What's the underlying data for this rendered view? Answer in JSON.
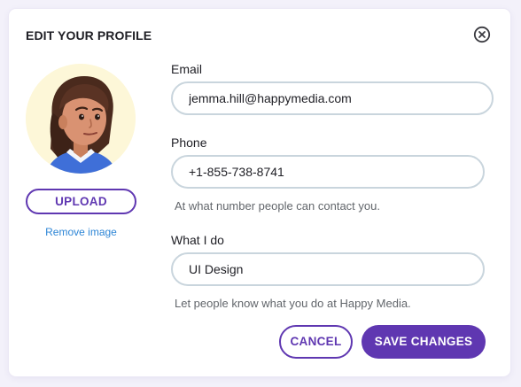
{
  "dialog": {
    "title": "EDIT YOUR PROFILE",
    "close_icon": "close-circle-icon"
  },
  "avatar": {
    "upload_label": "UPLOAD",
    "remove_label": "Remove image"
  },
  "form": {
    "email": {
      "label": "Email",
      "value": "jemma.hill@happymedia.com"
    },
    "phone": {
      "label": "Phone",
      "value": "+1-855-738-8741",
      "hint": "At what number people can contact you."
    },
    "what_i_do": {
      "label": "What I do",
      "value": "UI Design",
      "hint": "Let people know what you do at Happy Media."
    }
  },
  "actions": {
    "cancel_label": "CANCEL",
    "save_label": "SAVE CHANGES"
  },
  "colors": {
    "accent": "#5f37b1",
    "link": "#2e86d6",
    "field_border": "#c9d5dd",
    "avatar_bg": "#fdf7d8"
  }
}
